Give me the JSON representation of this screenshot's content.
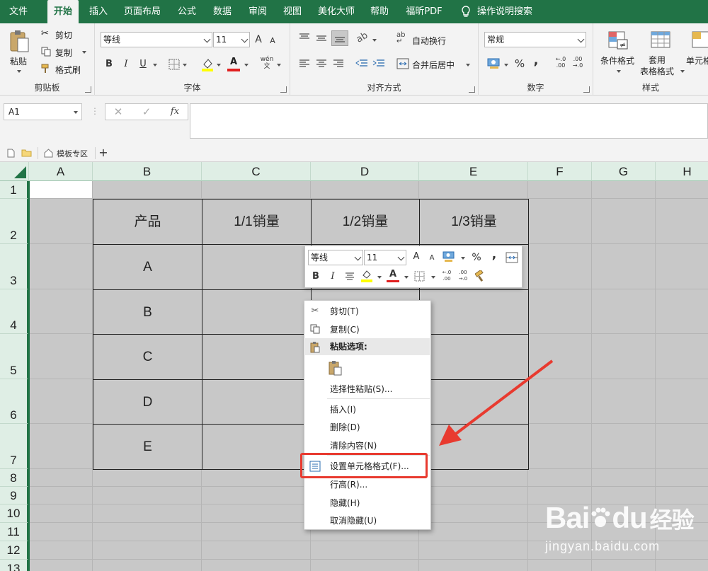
{
  "menubar": {
    "tabs": [
      "文件",
      "开始",
      "插入",
      "页面布局",
      "公式",
      "数据",
      "审阅",
      "视图",
      "美化大师",
      "帮助",
      "福昕PDF"
    ],
    "active": "开始",
    "search": "操作说明搜索"
  },
  "ribbon": {
    "clipboard": {
      "paste": "粘贴",
      "cut": "剪切",
      "copy": "复制",
      "format_painter": "格式刷",
      "label": "剪贴板"
    },
    "font": {
      "name": "等线",
      "size": "11",
      "grow": "A",
      "shrink": "A",
      "bold": "B",
      "italic": "I",
      "underline": "U",
      "font_color_glyph": "A",
      "phonetic_glyph": "wén",
      "label": "字体"
    },
    "alignment": {
      "wrap": "自动换行",
      "merge": "合并后居中",
      "label": "对齐方式"
    },
    "number": {
      "format": "常规",
      "percent": "%",
      "comma": ",",
      "inc_decimal": "←.0\n.00",
      "dec_decimal": ".00\n→.0",
      "label": "数字"
    },
    "styles": {
      "conditional": "条件格式",
      "table": "套用\n表格格式",
      "cell": "单元格",
      "label": "样式"
    }
  },
  "formula_bar": {
    "name_box": "A1",
    "cancel": "✕",
    "enter": "✓",
    "fx": "fx",
    "value": ""
  },
  "sheet_tabs": {
    "template": "模板专区",
    "add": "+"
  },
  "columns": [
    "A",
    "B",
    "C",
    "D",
    "E",
    "F",
    "G",
    "H"
  ],
  "rows": [
    "1",
    "2",
    "3",
    "4",
    "5",
    "6",
    "7",
    "8",
    "9",
    "10",
    "11",
    "12",
    "13"
  ],
  "table": {
    "headers": [
      "产品",
      "1/1销量",
      "1/2销量",
      "1/3销量"
    ],
    "products": [
      "A",
      "B",
      "C",
      "D",
      "E"
    ]
  },
  "mini_toolbar": {
    "font": "等线",
    "size": "11",
    "percent": "%",
    "comma": ",",
    "bold": "B",
    "italic": "I",
    "font_color_glyph": "A"
  },
  "context_menu": {
    "items": [
      {
        "label": "剪切(T)",
        "icon": "scissors-icon"
      },
      {
        "label": "复制(C)",
        "icon": "copy-icon"
      },
      {
        "label": "粘贴选项:",
        "icon": "paste-icon"
      },
      {
        "label": "选择性粘贴(S)..."
      },
      {
        "label": "插入(I)"
      },
      {
        "label": "删除(D)"
      },
      {
        "label": "清除内容(N)"
      },
      {
        "label": "设置单元格格式(F)...",
        "icon": "format-cells-icon"
      },
      {
        "label": "行高(R)..."
      },
      {
        "label": "隐藏(H)"
      },
      {
        "label": "取消隐藏(U)"
      }
    ]
  },
  "watermark": {
    "brand": "Bai",
    "paw": "du",
    "suffix": "经验",
    "url": "jingyan.baidu.com"
  },
  "colors": {
    "excel_green": "#217346",
    "header_bg": "#dfeee5",
    "sheet_gray": "#c8c8c8",
    "highlight_red": "#e83a2f"
  }
}
